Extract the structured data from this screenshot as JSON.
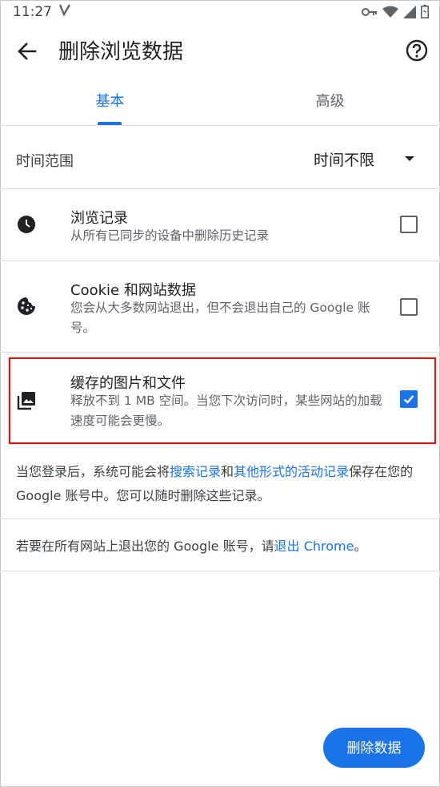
{
  "status_bar": {
    "time": "11:27",
    "icons": [
      "v-icon",
      "vpn-key-icon",
      "wifi-icon",
      "signal-icon",
      "battery-icon"
    ]
  },
  "app_bar": {
    "title": "删除浏览数据",
    "back_icon": "arrow-back-icon",
    "help_icon": "help-icon"
  },
  "tabs": [
    {
      "label": "基本",
      "selected": true
    },
    {
      "label": "高级",
      "selected": false
    }
  ],
  "time_range": {
    "label": "时间范围",
    "value": "时间不限"
  },
  "items": [
    {
      "title": "浏览记录",
      "subtitle": "从所有已同步的设备中删除历史记录",
      "icon": "clock-icon",
      "checked": false
    },
    {
      "title": "Cookie 和网站数据",
      "subtitle": "您会从大多数网站退出，但不会退出自己的 Google 账号。",
      "icon": "cookie-icon",
      "checked": false
    },
    {
      "title": "缓存的图片和文件",
      "subtitle": "释放不到 1 MB 空间。当您下次访问时，某些网站的加载速度可能会更慢。",
      "icon": "image-stack-icon",
      "checked": true
    }
  ],
  "info1": {
    "prefix": "当您登录后，系统可能会将",
    "link1": "搜索记录",
    "middle": "和",
    "link2": "其他形式的活动记录",
    "suffix": "保存在您的 Google 账号中。您可以随时删除这些记录。"
  },
  "info2": {
    "prefix": "若要在所有网站上退出您的 Google 账号，请",
    "link": "退出 Chrome",
    "suffix": "。"
  },
  "delete_button": "删除数据",
  "colors": {
    "accent": "#1a73e8",
    "highlight": "#d11b1b"
  }
}
